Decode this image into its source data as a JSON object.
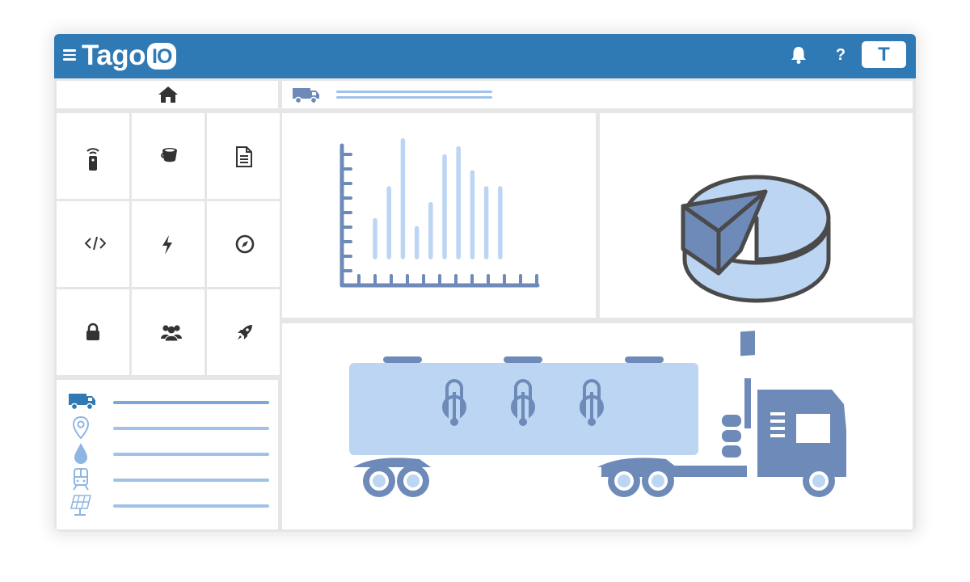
{
  "app": {
    "logo_text": "Tago",
    "logo_badge": "IO"
  },
  "header": {
    "help_label": "?",
    "avatar_initial": "T"
  },
  "icons": {
    "menu": "hamburger-menu-icon",
    "notifications": "bell-icon",
    "help": "question-mark",
    "home": "home-icon",
    "vehicle": "truck-icon"
  },
  "grid_icons": [
    "remote-device-icon",
    "bucket-icon",
    "file-icon",
    "code-icon",
    "lightning-icon",
    "compass-icon",
    "lock-icon",
    "users-icon",
    "rocket-icon"
  ],
  "list_icons": [
    "truck-icon",
    "location-pin-icon",
    "water-drop-icon",
    "train-icon",
    "solar-panel-icon"
  ],
  "chart_data": {
    "type": "bar",
    "values": [
      5,
      9,
      15,
      4,
      7,
      13,
      14,
      11,
      9,
      9
    ],
    "ylim": [
      0,
      18
    ]
  },
  "colors": {
    "header": "#2f79b4",
    "light_blue": "#bcd5f2",
    "slate_blue": "#6d8ab8",
    "dark_gray": "#4a4a4a"
  }
}
